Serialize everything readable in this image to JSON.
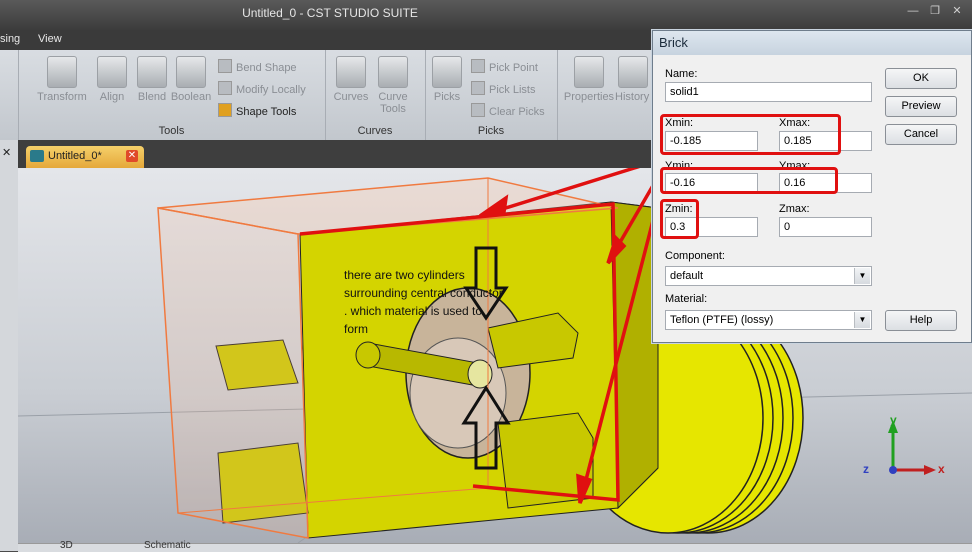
{
  "app": {
    "title": "Untitled_0 - CST STUDIO SUITE"
  },
  "window_controls": {
    "minimize": "—",
    "restore": "❐",
    "close": "✕"
  },
  "menu": {
    "items": [
      "sing",
      "View"
    ]
  },
  "ribbon": {
    "groups": [
      {
        "label": "Tools",
        "buttons": [
          "Transform",
          "Align",
          "Blend",
          "Boolean"
        ],
        "small": [
          "Bend Shape",
          "Modify Locally",
          "Shape Tools"
        ]
      },
      {
        "label": "Curves",
        "buttons": [
          "Curves",
          "Curve Tools"
        ]
      },
      {
        "label": "Picks",
        "buttons": [
          "Picks"
        ],
        "small": [
          "Pick Point",
          "Pick Lists",
          "Clear Picks"
        ]
      },
      {
        "label": "",
        "buttons": [
          "Properties",
          "History List"
        ]
      }
    ]
  },
  "doc_tab": {
    "label": "Untitled_0*",
    "close": "✕"
  },
  "left_strip": {
    "close": "✕"
  },
  "annotation": "there are two cylinders surrounding central conductor . which material is used to form",
  "bottom_tabs": [
    "3D",
    "Schematic"
  ],
  "axes": {
    "y": "y",
    "z": "z",
    "x": "x"
  },
  "dialog": {
    "title": "Brick",
    "name_label": "Name:",
    "name_value": "solid1",
    "xmin_label": "Xmin:",
    "xmin_value": "-0.185",
    "xmax_label": "Xmax:",
    "xmax_value": "0.185",
    "ymin_label": "Ymin:",
    "ymin_value": "-0.16",
    "ymax_label": "Ymax:",
    "ymax_value": "0.16",
    "zmin_label": "Zmin:",
    "zmin_value": "0.3",
    "zmax_label": "Zmax:",
    "zmax_value": "0",
    "component_label": "Component:",
    "component_value": "default",
    "material_label": "Material:",
    "material_value": "Teflon (PTFE) (lossy)",
    "ok": "OK",
    "preview": "Preview",
    "cancel": "Cancel",
    "help": "Help"
  },
  "colors": {
    "annotation_red": "#e01010",
    "model_yellow": "#e6e600",
    "brick_outline": "#f07a40"
  }
}
